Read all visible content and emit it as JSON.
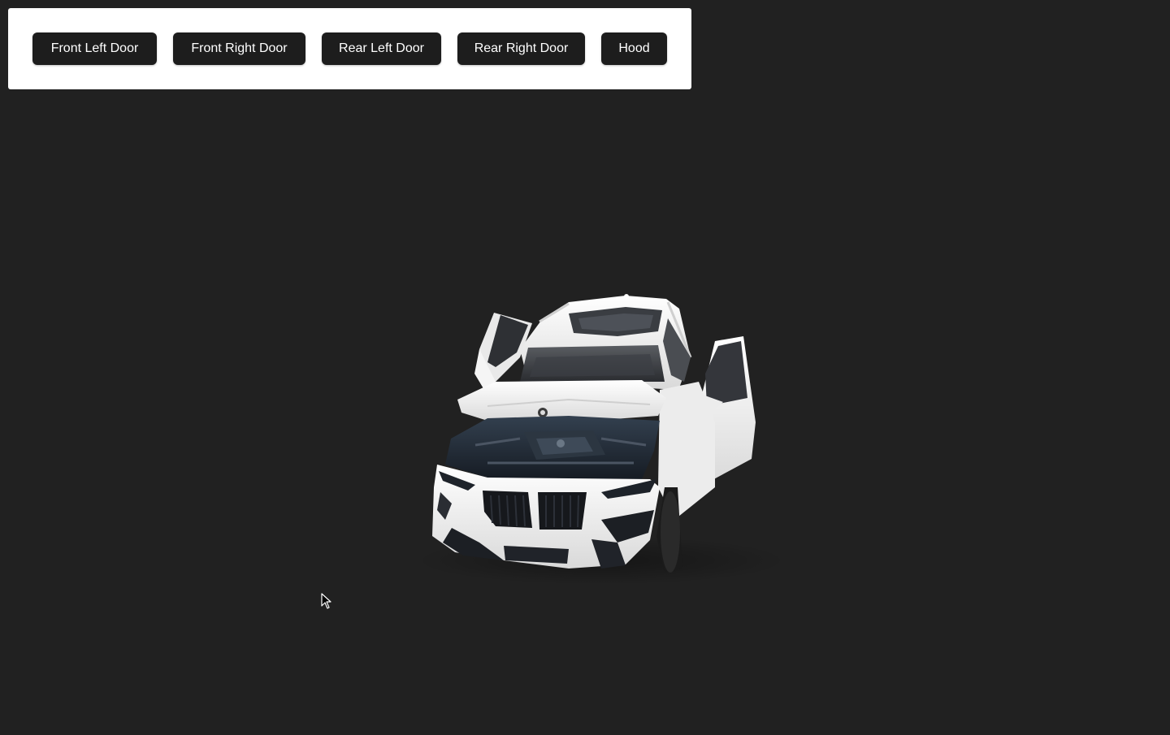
{
  "controls": {
    "front_left_door": "Front Left Door",
    "front_right_door": "Front Right Door",
    "rear_left_door": "Rear Left Door",
    "rear_right_door": "Rear Right Door",
    "hood": "Hood"
  },
  "scene": {
    "background_color": "#212121",
    "car_color": "#f2f2f2",
    "model_state": {
      "front_left_door": "open",
      "front_right_door": "open",
      "rear_left_door": "closed",
      "rear_right_door": "closed",
      "hood": "open"
    }
  },
  "icons": {
    "cursor": "arrow-cursor-icon"
  }
}
